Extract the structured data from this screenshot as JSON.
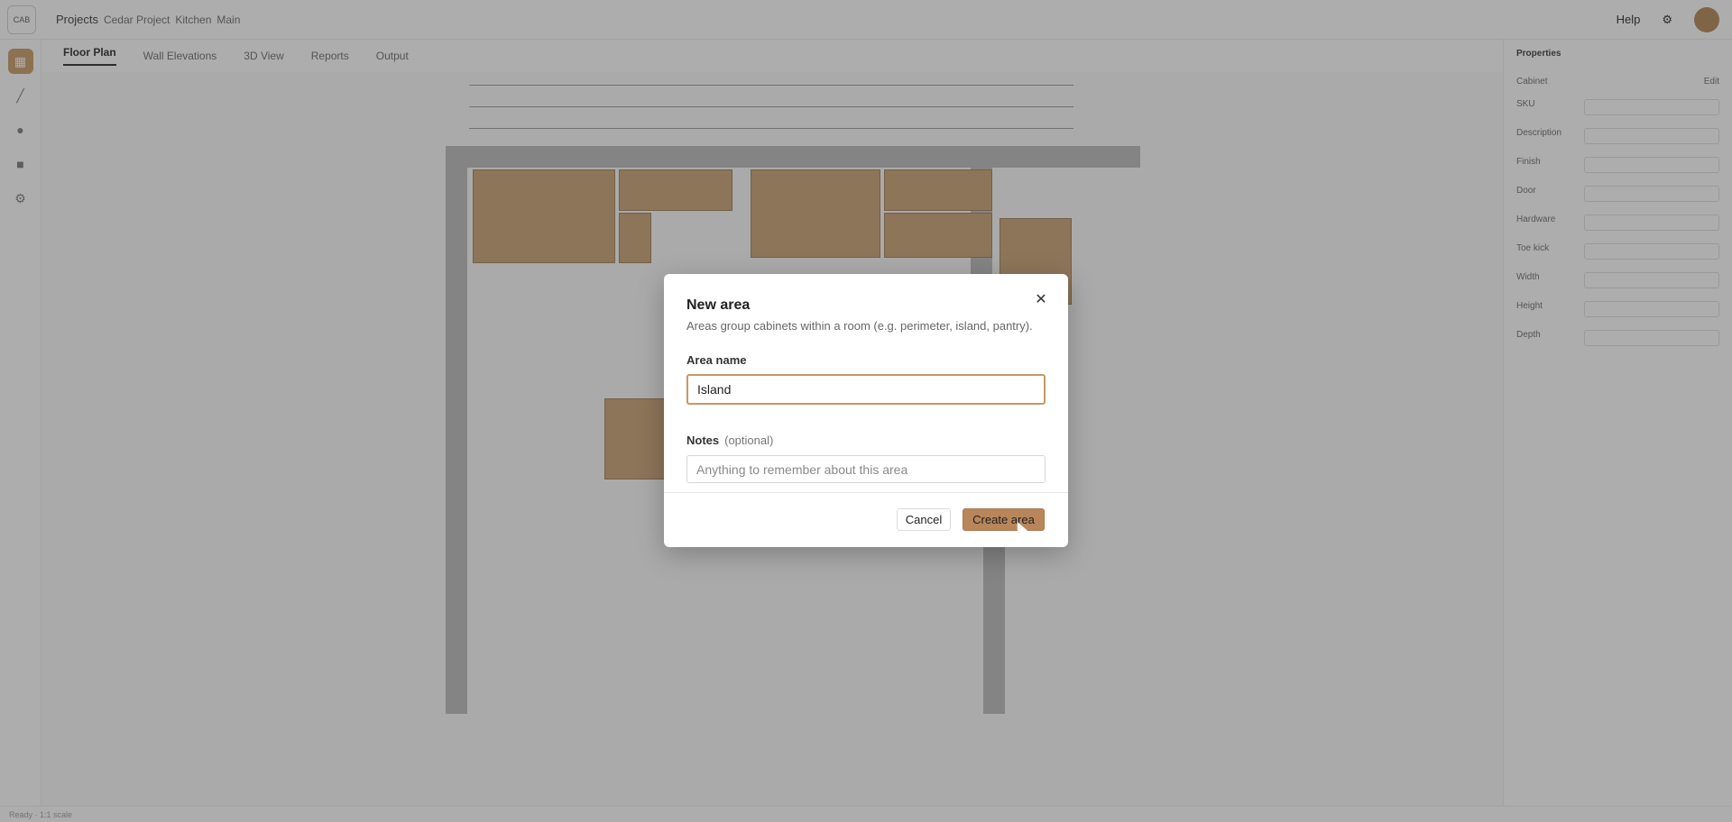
{
  "topbar": {
    "logo_text": "CAB",
    "crumb_projects": "Projects",
    "crumb_project": "Cedar Project",
    "crumb_room": "Kitchen",
    "crumb_level": "Main",
    "help_label": "Help"
  },
  "subtabs": [
    "Floor Plan",
    "Wall Elevations",
    "3D View",
    "Reports",
    "Output"
  ],
  "right_panel": {
    "title": "Properties",
    "section": "Cabinet",
    "edit_label": "Edit",
    "rows": [
      "SKU",
      "Description",
      "Finish",
      "Door",
      "Hardware",
      "Toe kick",
      "Width",
      "Height",
      "Depth"
    ]
  },
  "status_text": "Ready · 1:1 scale",
  "dialog": {
    "title": "New area",
    "subtitle": "Areas group cabinets within a room (e.g. perimeter, island, pantry).",
    "area_name_label": "Area name",
    "area_name_value": "Island",
    "notes_label": "Notes",
    "notes_optional": "(optional)",
    "notes_placeholder": "Anything to remember about this area",
    "cancel_label": "Cancel",
    "create_label": "Create area",
    "close_glyph": "✕"
  },
  "colors": {
    "accent": "#c69863",
    "create_button": "#b8865a",
    "cabinet": "#c89f6e"
  }
}
